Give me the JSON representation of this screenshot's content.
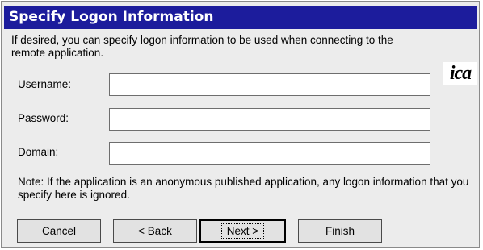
{
  "dialog": {
    "title": "Specify Logon Information",
    "description": "If desired, you can specify logon information to be used when connecting to the remote application.",
    "logo_text": "ica",
    "fields": {
      "username": {
        "label": "Username:",
        "value": ""
      },
      "password": {
        "label": "Password:",
        "value": ""
      },
      "domain": {
        "label": "Domain:",
        "value": ""
      }
    },
    "note": "Note: If the application is an anonymous published application, any logon information that you specify here is ignored.",
    "buttons": {
      "cancel": "Cancel",
      "back": "< Back",
      "next": "Next >",
      "finish": "Finish"
    }
  },
  "colors": {
    "title_bar": "#1c1c9c",
    "title_text": "#ffffff",
    "dialog_bg": "#ececec"
  }
}
